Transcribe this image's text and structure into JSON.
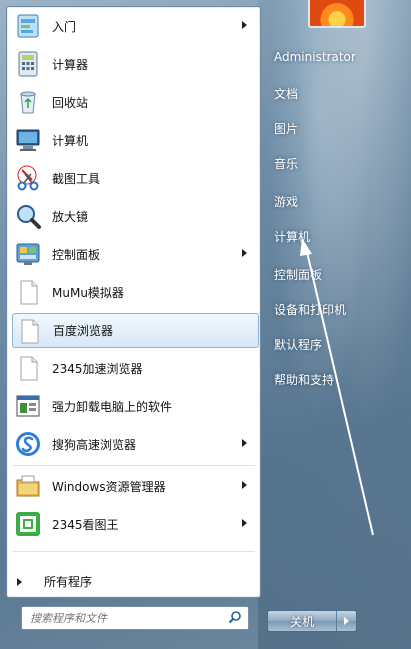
{
  "programs": [
    {
      "label": "入门",
      "icon": "getting-started-icon",
      "submenu": true
    },
    {
      "label": "计算器",
      "icon": "calculator-icon",
      "submenu": false
    },
    {
      "label": "回收站",
      "icon": "recycle-bin-icon",
      "submenu": false
    },
    {
      "label": "计算机",
      "icon": "computer-icon",
      "submenu": false
    },
    {
      "label": "截图工具",
      "icon": "snipping-tool-icon",
      "submenu": false
    },
    {
      "label": "放大镜",
      "icon": "magnifier-icon",
      "submenu": false
    },
    {
      "label": "控制面板",
      "icon": "control-panel-icon",
      "submenu": true
    },
    {
      "label": "MuMu模拟器",
      "icon": "blank-file-icon",
      "submenu": false
    },
    {
      "label": "百度浏览器",
      "icon": "blank-file-icon",
      "submenu": false,
      "selected": true
    },
    {
      "label": "2345加速浏览器",
      "icon": "blank-file-icon",
      "submenu": false
    },
    {
      "label": "强力卸载电脑上的软件",
      "icon": "uninstaller-icon",
      "submenu": false
    },
    {
      "label": "搜狗高速浏览器",
      "icon": "sogou-browser-icon",
      "submenu": true
    },
    {
      "label": "Windows资源管理器",
      "icon": "explorer-icon",
      "submenu": true
    },
    {
      "label": "2345看图王",
      "icon": "image-viewer-icon",
      "submenu": true
    }
  ],
  "all_programs": "所有程序",
  "search": {
    "placeholder": "搜索程序和文件"
  },
  "right": {
    "user": "Administrator",
    "items": [
      "文档",
      "图片",
      "音乐",
      "游戏",
      "计算机",
      "控制面板",
      "设备和打印机",
      "默认程序",
      "帮助和支持"
    ]
  },
  "shutdown": {
    "label": "关机"
  },
  "colors": {
    "selected_bg": "#d6e7f7",
    "selected_border": "#8fb2d8",
    "arrow": "#ffffff"
  }
}
